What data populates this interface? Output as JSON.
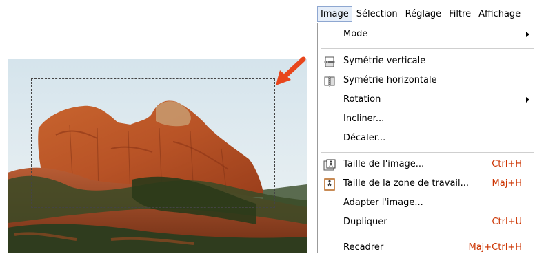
{
  "menubar": {
    "items": [
      {
        "label": "Image",
        "active": true
      },
      {
        "label": "Sélection"
      },
      {
        "label": "Réglage"
      },
      {
        "label": "Filtre"
      },
      {
        "label": "Affichage"
      }
    ]
  },
  "image_menu": {
    "mode": {
      "label": "Mode",
      "submenu": true
    },
    "flip_vertical": {
      "label": "Symétrie verticale",
      "icon": "flip-vertical-icon"
    },
    "flip_horizontal": {
      "label": "Symétrie horizontale",
      "icon": "flip-horizontal-icon"
    },
    "rotation": {
      "label": "Rotation",
      "submenu": true
    },
    "skew": {
      "label": "Incliner..."
    },
    "offset": {
      "label": "Décaler..."
    },
    "image_size": {
      "label": "Taille de l'image...",
      "shortcut": "Ctrl+H",
      "icon": "image-size-icon"
    },
    "canvas_size": {
      "label": "Taille de la zone de travail...",
      "shortcut": "Maj+H",
      "icon": "canvas-size-icon"
    },
    "fit_image": {
      "label": "Adapter l'image..."
    },
    "duplicate": {
      "label": "Dupliquer",
      "shortcut": "Ctrl+U"
    },
    "crop": {
      "label": "Recadrer",
      "shortcut": "Maj+Ctrl+H"
    }
  },
  "colors": {
    "accent_arrow": "#e8461c",
    "shortcut_text": "#cc3300",
    "menu_active_bg": "#e6eef9"
  }
}
